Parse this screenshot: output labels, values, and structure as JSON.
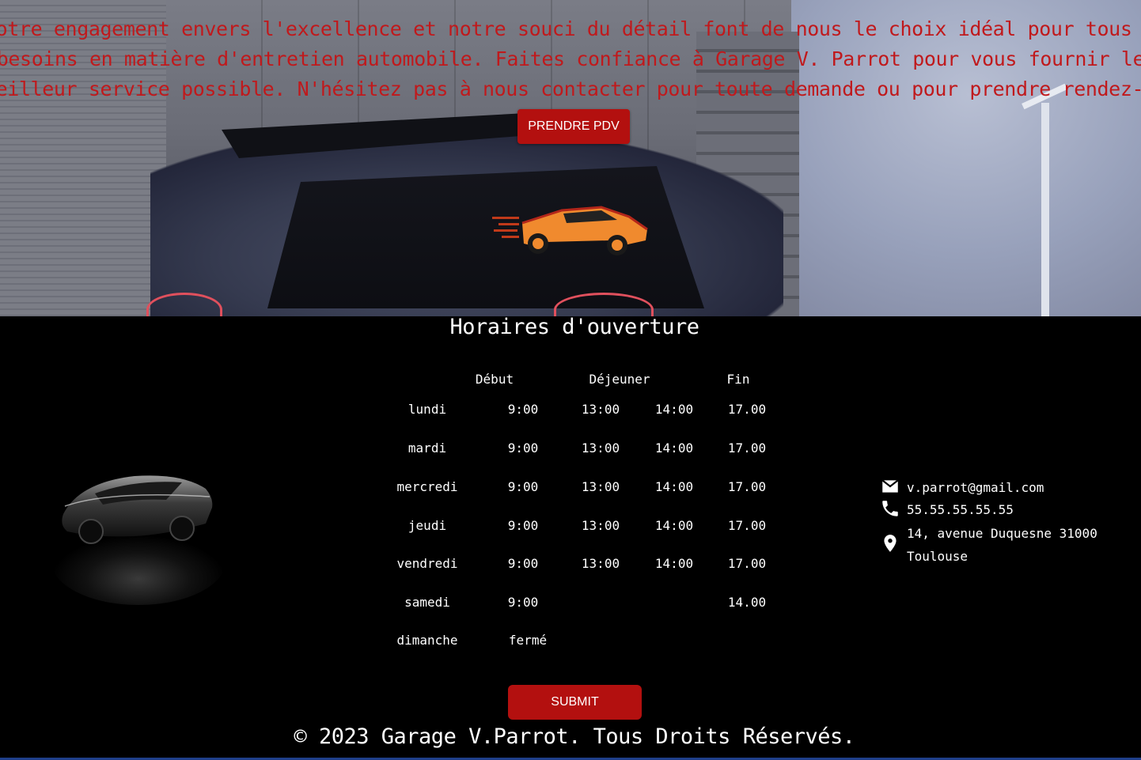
{
  "hero": {
    "lines": [
      "Notre engagement envers l'excellence et notre souci du détail font de nous le choix idéal pour tous vos",
      "besoins en matière d'entretien automobile. Faites confiance à Garage V. Parrot pour vous fournir le",
      "meilleur service possible. N'hésitez pas à nous contacter pour toute demande ou pour prendre rendez-vous."
    ],
    "button_label": "PRENDRE PDV"
  },
  "hours": {
    "title": "Horaires d'ouverture",
    "headers": {
      "start": "Début",
      "lunch": "Déjeuner",
      "end": "Fin"
    },
    "rows": [
      {
        "day": "lundi",
        "start": "9:00",
        "lunch_start": "13:00",
        "lunch_end": "14:00",
        "end": "17.00"
      },
      {
        "day": "mardi",
        "start": "9:00",
        "lunch_start": "13:00",
        "lunch_end": "14:00",
        "end": "17.00"
      },
      {
        "day": "mercredi",
        "start": "9:00",
        "lunch_start": "13:00",
        "lunch_end": "14:00",
        "end": "17.00"
      },
      {
        "day": "jeudi",
        "start": "9:00",
        "lunch_start": "13:00",
        "lunch_end": "14:00",
        "end": "17.00"
      },
      {
        "day": "vendredi",
        "start": "9:00",
        "lunch_start": "13:00",
        "lunch_end": "14:00",
        "end": "17.00"
      },
      {
        "day": "samedi",
        "start": "9:00",
        "lunch_start": "",
        "lunch_end": "",
        "end": "14.00"
      },
      {
        "day": "dimanche",
        "start": "fermé",
        "lunch_start": "",
        "lunch_end": "",
        "end": ""
      }
    ]
  },
  "contact": {
    "email": "v.parrot@gmail.com",
    "phone": "55.55.55.55.55",
    "address_line1": "14, avenue Duquesne 31000",
    "address_line2": "Toulouse",
    "icons": [
      "email-icon",
      "phone-icon",
      "location-pin-icon"
    ]
  },
  "submit_label": "SUBMIT",
  "footer": "© 2023 Garage V.Parrot. Tous Droits Réservés.",
  "colors": {
    "accent": "#b3100f",
    "hero_text": "#c0191c",
    "background": "#000000",
    "logo_orange": "#f08a2e"
  }
}
